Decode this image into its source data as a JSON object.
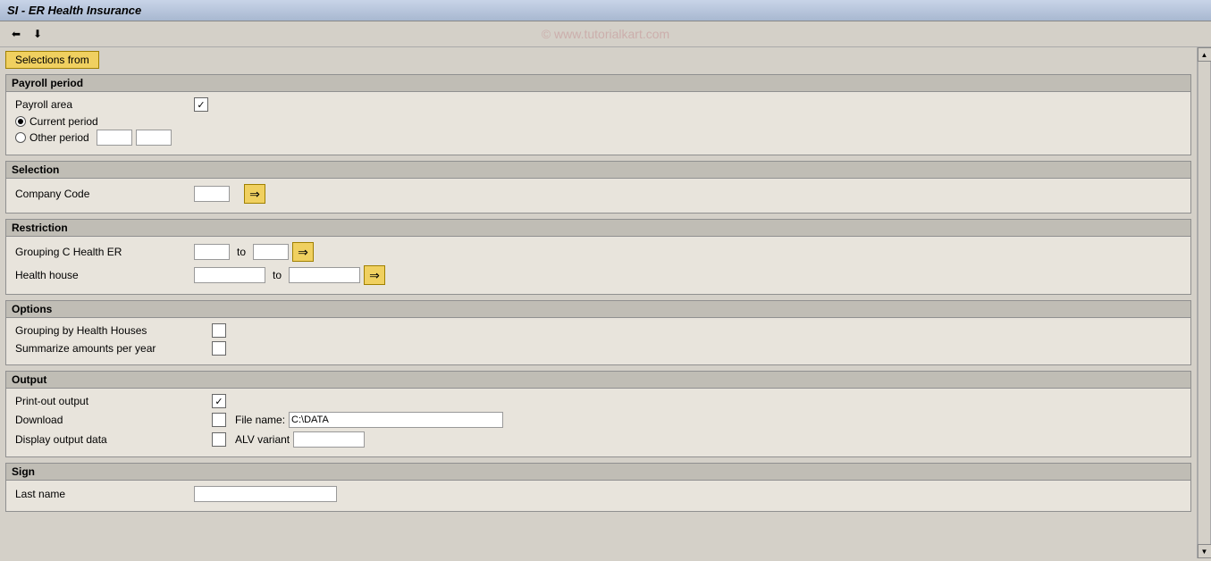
{
  "titleBar": {
    "title": "SI - ER Health Insurance"
  },
  "toolbar": {
    "watermark": "© www.tutorialkart.com",
    "icons": [
      "back-icon",
      "forward-icon"
    ]
  },
  "selectionsBtn": {
    "label": "Selections from"
  },
  "sections": {
    "payrollPeriod": {
      "header": "Payroll period",
      "payrollAreaLabel": "Payroll area",
      "currentPeriodLabel": "Current period",
      "otherPeriodLabel": "Other period"
    },
    "selection": {
      "header": "Selection",
      "companyCodeLabel": "Company Code"
    },
    "restriction": {
      "header": "Restriction",
      "groupingLabel": "Grouping C Health ER",
      "healthHouseLabel": "Health house",
      "toLabel": "to"
    },
    "options": {
      "header": "Options",
      "groupingByLabel": "Grouping by Health Houses",
      "summarizeLabel": "Summarize amounts per year"
    },
    "output": {
      "header": "Output",
      "printOutLabel": "Print-out output",
      "downloadLabel": "Download",
      "fileNameLabel": "File name:",
      "fileNameValue": "C:\\DATA",
      "displayOutputLabel": "Display output data",
      "alvVariantLabel": "ALV variant"
    },
    "sign": {
      "header": "Sign",
      "lastNameLabel": "Last name"
    }
  }
}
